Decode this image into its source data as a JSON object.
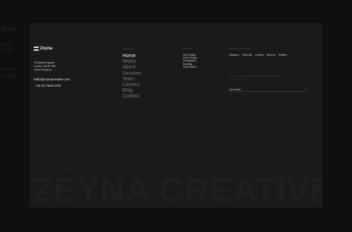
{
  "backdrop": {
    "ghost_a": "Zeyna",
    "ghost_b": "Works",
    "ghost_c": "About",
    "ghost_d": "Services",
    "ghost_e": "Contact",
    "ghost_f": "",
    "ghost_g": "",
    "ghost_h": ""
  },
  "brand": {
    "name": "Zeyna"
  },
  "contact": {
    "address": [
      "33 Bedford Square",
      "London, WC1B 3HH",
      "United Kingdom"
    ],
    "email": "hello@zeynacreative.com",
    "phone": "+44 20 7946 0733"
  },
  "navigation": {
    "heading": "Navigation",
    "items": [
      "Home",
      "Works",
      "About",
      "Services",
      "Team",
      "Careers",
      "Blog",
      "Contact"
    ]
  },
  "services": {
    "heading": "Services",
    "items": [
      "Web Design",
      "UX/UI Design",
      "Photography",
      "Branding",
      "Social Media"
    ]
  },
  "social": {
    "heading": "Follow us on socials",
    "items": [
      "Instagram",
      "Facebook",
      "LinkedIn",
      "Behance",
      "Dribbble"
    ]
  },
  "newsletter": {
    "text": "Join our newsletter to get the latest updates and news delivered",
    "placeholder": "Your email",
    "submit_symbol": "→"
  },
  "footer": {
    "copyright": "© 2024 Zeyna Creative — All rights reserved",
    "back_to_top": "Back to top",
    "big_text": "ZEYNA CREATIVE"
  },
  "colors": {
    "panel": "#1a1a1a",
    "accent": "#f0f0f0"
  }
}
